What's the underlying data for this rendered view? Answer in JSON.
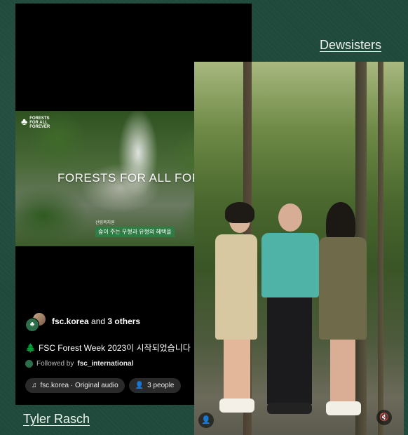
{
  "links": {
    "right": "Dewsisters",
    "left": "Tyler Rasch"
  },
  "reel": {
    "video": {
      "logo_text": "FORESTS FOR ALL FOREVER",
      "headline": "FORESTS FOR ALL FOREVER",
      "tag_top": "산림복지원",
      "tag_box": "숲이 주는 무형과 유형의 혜택을"
    },
    "owners": {
      "account": "fsc.korea",
      "and_text": "and",
      "others": "3 others"
    },
    "caption": "FSC Forest Week 2023이 시작되었습니다",
    "followed": {
      "prefix": "Followed by",
      "account": "fsc_international"
    },
    "audio_pill": "fsc.korea · Original audio",
    "people_pill": "3 people"
  },
  "icons": {
    "caption_tree": "🌲",
    "music": "♫",
    "person": "👤",
    "muted": "🔇"
  }
}
